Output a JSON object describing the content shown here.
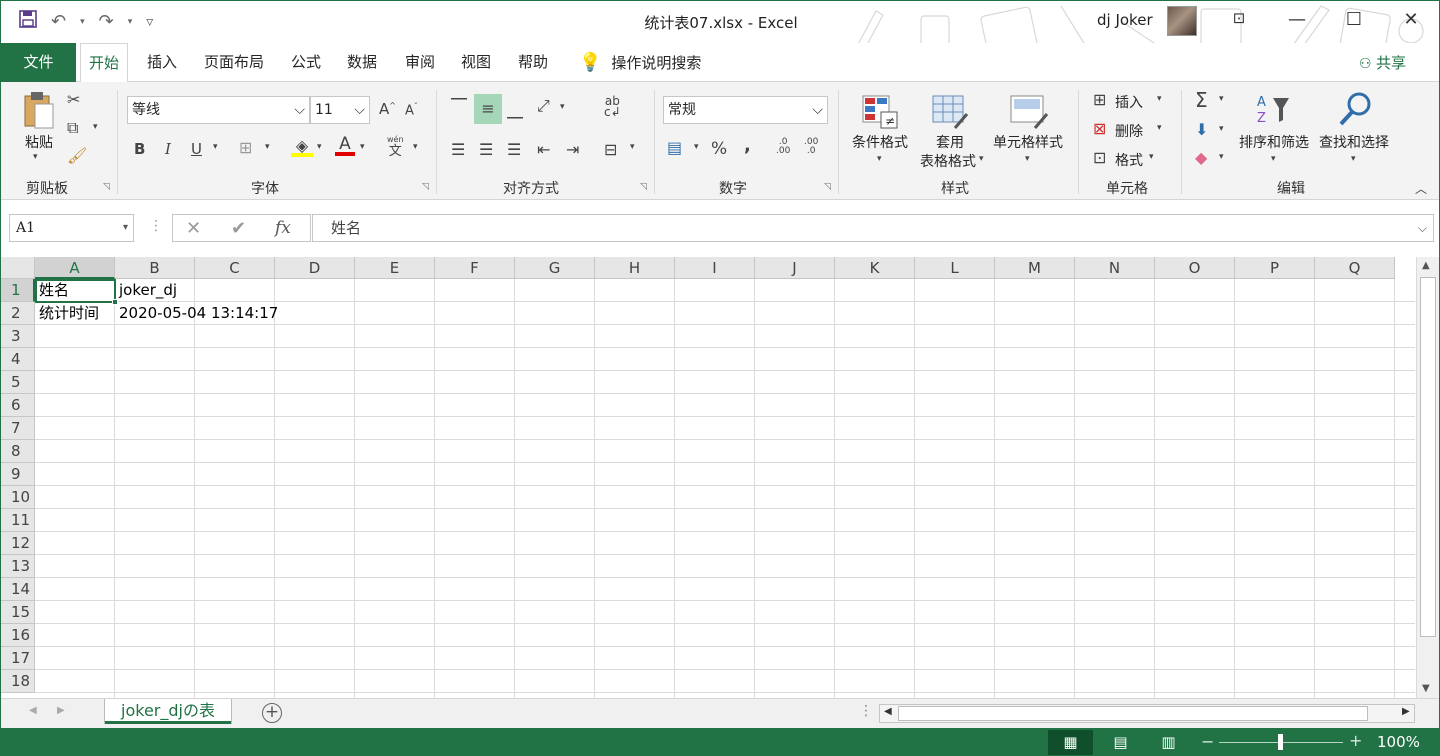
{
  "window": {
    "title": "统计表07.xlsx  -  Excel",
    "user_name": "dj Joker",
    "minimize": "—",
    "maximize": "☐",
    "close": "✕",
    "ribbon_display": "⊡"
  },
  "qat": {
    "save_icon": "save-icon",
    "undo": "↶",
    "redo": "↷",
    "customize": "▿"
  },
  "tabs": {
    "file": "文件",
    "items": [
      "开始",
      "插入",
      "页面布局",
      "公式",
      "数据",
      "审阅",
      "视图",
      "帮助"
    ],
    "tell_me": "操作说明搜索",
    "share": "共享"
  },
  "ribbon": {
    "clipboard": {
      "label": "剪贴板",
      "paste": "粘贴"
    },
    "font": {
      "label": "字体",
      "name": "等线",
      "size": "11",
      "bold": "B",
      "italic": "I",
      "underline": "U",
      "grow": "A",
      "shrink": "A",
      "font_color_letter": "A",
      "phonetic": "wén",
      "phonetic_char": "文"
    },
    "alignment": {
      "label": "对齐方式",
      "wrap": "ab",
      "wrap2": "c"
    },
    "number": {
      "label": "数字",
      "format": "常规",
      "percent": "%",
      "comma": ",",
      "inc_decimal": ".0\n.00",
      "dec_decimal": ".00\n.0"
    },
    "styles": {
      "label": "样式",
      "conditional": "条件格式",
      "table_line1": "套用",
      "table_line2": "表格格式",
      "cell_styles": "单元格样式"
    },
    "cells": {
      "label": "单元格",
      "insert": "插入",
      "delete": "删除",
      "format": "格式"
    },
    "editing": {
      "label": "编辑",
      "sort_filter": "排序和筛选",
      "find_select": "查找和选择",
      "sigma": "Σ"
    }
  },
  "formula_bar": {
    "name_box": "A1",
    "cancel": "✕",
    "enter": "✔",
    "fx": "fx",
    "content": "姓名"
  },
  "grid": {
    "columns": [
      "A",
      "B",
      "C",
      "D",
      "E",
      "F",
      "G",
      "H",
      "I",
      "J",
      "K",
      "L",
      "M",
      "N",
      "O",
      "P",
      "Q"
    ],
    "rows": [
      "1",
      "2",
      "3",
      "4",
      "5",
      "6",
      "7",
      "8",
      "9",
      "10",
      "11",
      "12",
      "13",
      "14",
      "15",
      "16",
      "17",
      "18"
    ],
    "cells": {
      "A1": "姓名",
      "B1": "joker_dj",
      "A2": "统计时间",
      "B2": "2020-05-04 13:14:17"
    },
    "selected": "A1"
  },
  "sheets": {
    "tabs": [
      "joker_djの表"
    ],
    "add": "+"
  },
  "status": {
    "zoom": "100%",
    "zoom_level": 1.0
  },
  "colors": {
    "accent": "#217346",
    "ribbon_bg": "#f3f3f3",
    "grid_line": "#dadada"
  }
}
